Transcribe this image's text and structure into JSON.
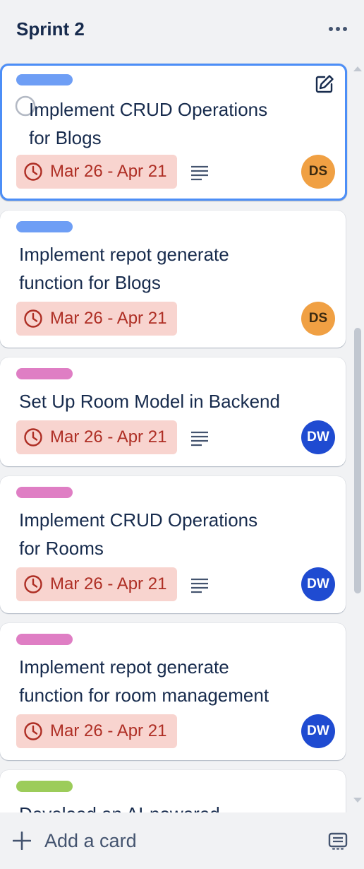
{
  "list": {
    "title": "Sprint 2"
  },
  "cards": [
    {
      "label_color": "#6e9ef5",
      "title_line1": "Implement CRUD Operations",
      "title_line2": "for Blogs",
      "date": "Mar 26 - Apr 21",
      "has_description": true,
      "avatar": "DS"
    },
    {
      "label_color": "#6e9ef5",
      "title_line1": "Implement repot generate",
      "title_line2": "function for Blogs",
      "date": "Mar 26 - Apr 21",
      "has_description": false,
      "avatar": "DS"
    },
    {
      "label_color": "#df7ec4",
      "title_line1": "Set Up Room Model in Backend",
      "date": "Mar 26 - Apr 21",
      "has_description": true,
      "avatar": "DW"
    },
    {
      "label_color": "#df7ec4",
      "title_line1": "Implement CRUD Operations",
      "title_line2": "for Rooms",
      "date": "Mar 26 - Apr 21",
      "has_description": true,
      "avatar": "DW"
    },
    {
      "label_color": "#df7ec4",
      "title_line1": "Implement repot generate",
      "title_line2": "function for room management",
      "date": "Mar 26 - Apr 21",
      "has_description": false,
      "avatar": "DW"
    },
    {
      "label_color": "#9ccc5a",
      "title_line1": "Develoed an AI-powered"
    }
  ],
  "footer": {
    "add_label": "Add a card"
  },
  "icons": {
    "more": "more-icon",
    "edit": "edit-icon",
    "radio": "radio-circle-icon",
    "clock": "clock-icon",
    "description": "description-icon",
    "plus": "plus-icon",
    "template": "template-icon"
  }
}
